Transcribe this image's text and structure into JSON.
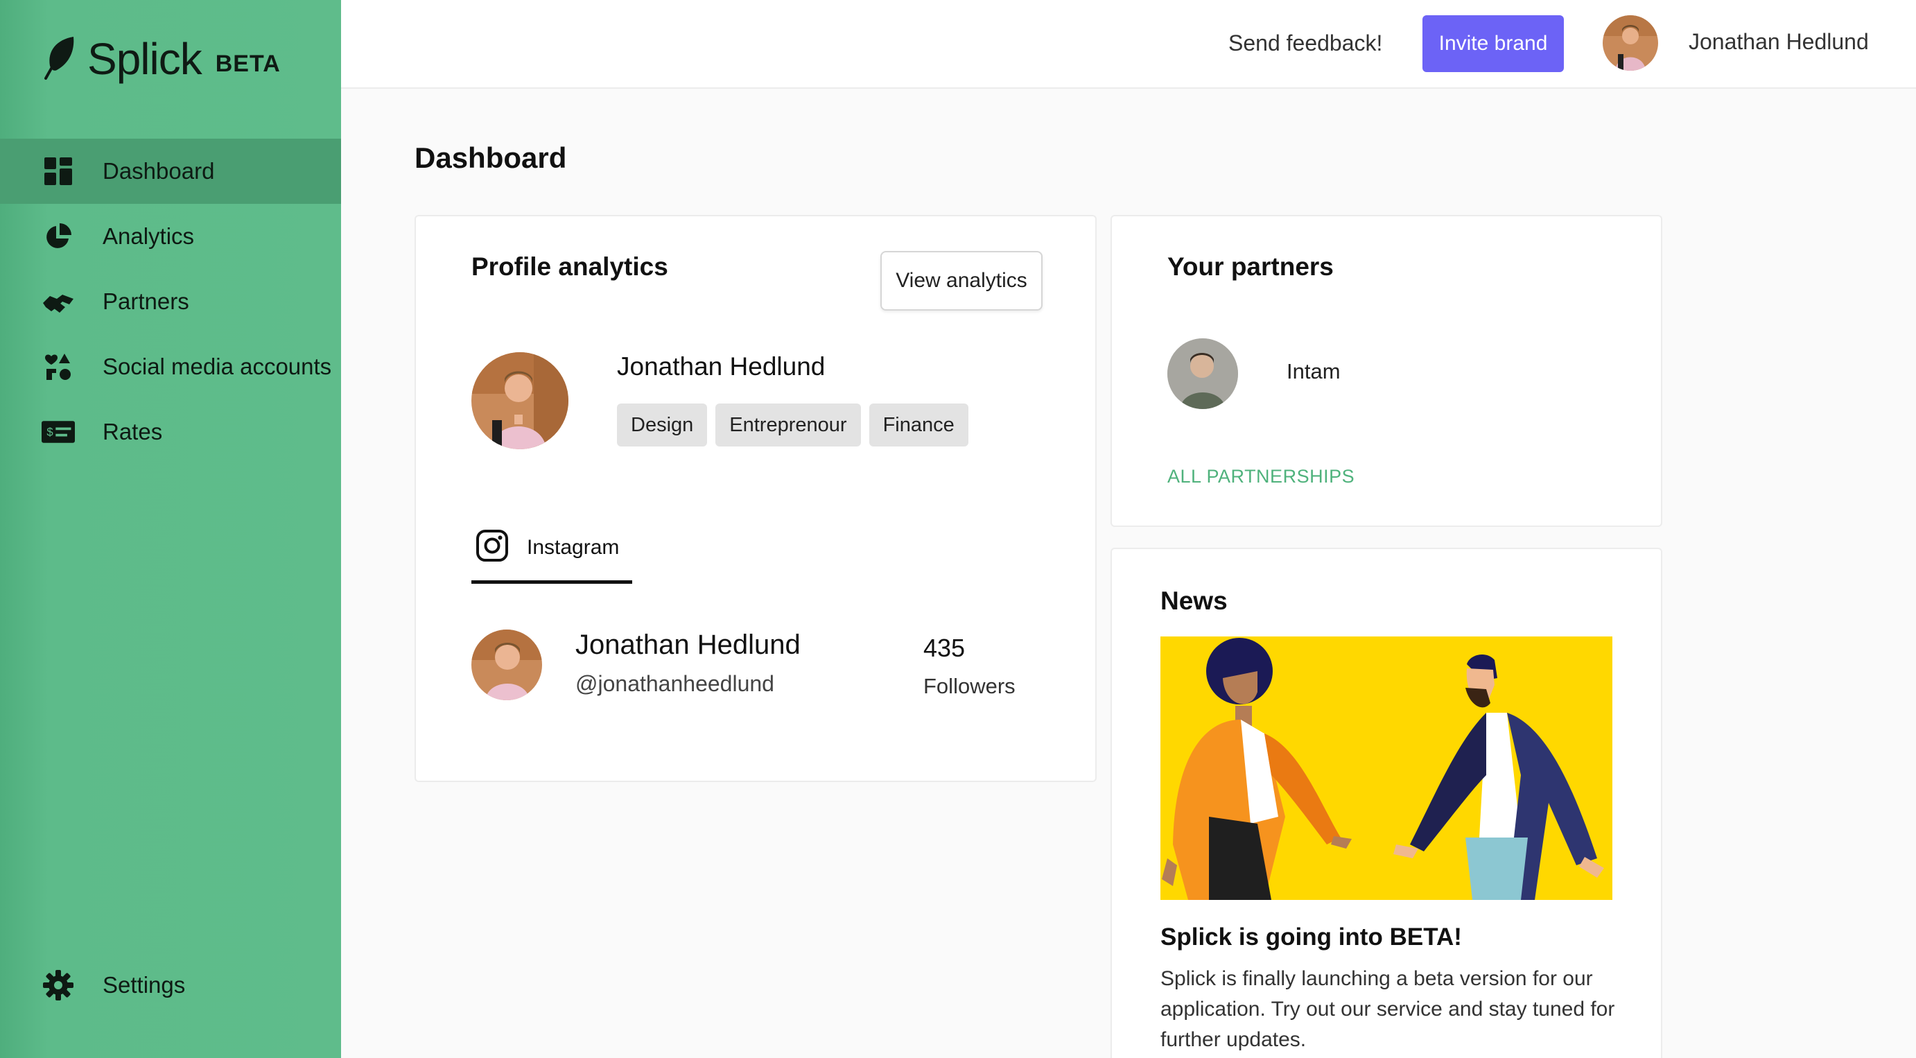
{
  "app": {
    "name": "Splick",
    "badge": "BETA"
  },
  "sidebar": {
    "items": [
      {
        "label": "Dashboard",
        "icon": "grid-icon",
        "active": true
      },
      {
        "label": "Analytics",
        "icon": "pie-chart-icon",
        "active": false
      },
      {
        "label": "Partners",
        "icon": "handshake-icon",
        "active": false
      },
      {
        "label": "Social media accounts",
        "icon": "shapes-icon",
        "active": false
      },
      {
        "label": "Rates",
        "icon": "money-check-icon",
        "active": false
      }
    ],
    "settings_label": "Settings"
  },
  "topbar": {
    "feedback_label": "Send feedback!",
    "invite_label": "Invite brand",
    "user_name": "Jonathan Hedlund"
  },
  "page": {
    "title": "Dashboard"
  },
  "profile_analytics": {
    "title": "Profile analytics",
    "view_button": "View analytics",
    "name": "Jonathan Hedlund",
    "tags": [
      "Design",
      "Entreprenour",
      "Finance"
    ],
    "tab_label": "Instagram",
    "account": {
      "name": "Jonathan Hedlund",
      "handle": "@jonathanheedlund",
      "followers_count": "435",
      "followers_label": "Followers"
    }
  },
  "partners": {
    "title": "Your partners",
    "items": [
      {
        "name": "Intam"
      }
    ],
    "all_link": "ALL PARTNERSHIPS"
  },
  "news": {
    "title": "News",
    "headline": "Splick is going into BETA!",
    "body": "Splick is finally launching a beta version for our application. Try out our service and stay tuned for further updates."
  },
  "colors": {
    "sidebar": "#5fbc8b",
    "sidebar_active": "#4a9e72",
    "accent": "#6c63f6",
    "link": "#4fb27c",
    "news_bg": "#ffd800"
  }
}
